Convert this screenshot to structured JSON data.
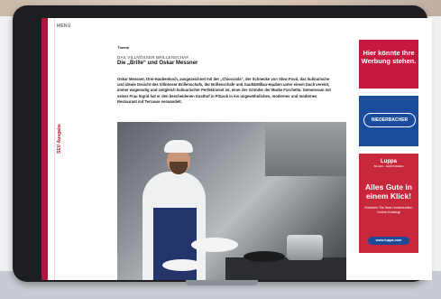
{
  "sidebar": {
    "menu_label": "MENÜ",
    "brand_vertical": "SEV·Ausgabe"
  },
  "article": {
    "kicker": "Thema",
    "subline": "DAS VILLNÖSSER BRILLENSCHAF",
    "headline": "Die „Brille“ und Oskar Messner",
    "body": "Oskar Messner, Drei-Haubenkoch, ausgezeichnet mit der „Chiocciola“, der Schnecke von Slow Food, das kulinarische und ideale Gesicht des Villnösser Brillenschafs, der Brillenschafe und Gault&Millau-Hauben unter einem Dach vereint, immer wagemutig und zeitgleich kulinarischer Perfektionist ist, einer der Gründer der Marke Furchetta. Gemeinsam mit seiner Frau Ingrid hat er den bescheidenen Gasthof in Pitzack in ein ungewöhnliches, modernes und modernes Restaurant mit Terrasse verwandelt."
  },
  "ads": {
    "ad1_text": "Hier könnte Ihre Werbung stehen.",
    "ad2_logo": "NIEDERBACHER",
    "ad3_brand": "Luppa",
    "ad3_tagline": "BAUEN · RENOVIEREN",
    "ad3_headline": "Alles Gute in einem Klick!",
    "ad3_sub": "Erstellen Sie Ihren individuellen Online-Katalog!",
    "ad3_button": "www.luppa.com"
  },
  "colors": {
    "accent": "#b3153a",
    "ad_red": "#c7193f",
    "ad_blue": "#1a4d9b"
  }
}
